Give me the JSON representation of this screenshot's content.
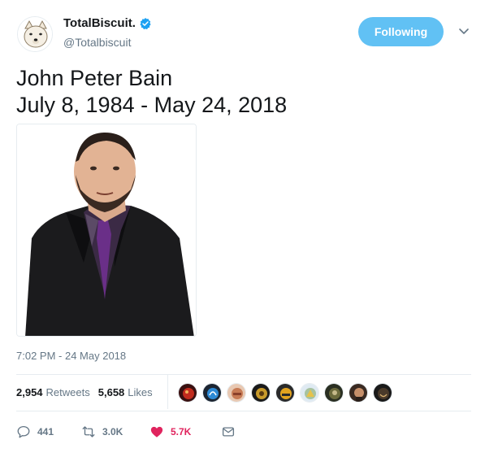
{
  "header": {
    "display_name": "TotalBiscuit.",
    "handle": "@Totalbiscuit",
    "verified_icon": "verified-badge-icon",
    "follow_button_label": "Following",
    "menu_icon": "chevron-down-icon"
  },
  "tweet": {
    "line1": "John Peter Bain",
    "line2": "July 8, 1984 - May 24, 2018",
    "timestamp": "7:02 PM - 24 May 2018"
  },
  "stats": {
    "retweets_count": "2,954",
    "retweets_label": "Retweets",
    "likes_count": "5,658",
    "likes_label": "Likes",
    "liker_avatars": 9
  },
  "actions": {
    "reply_count": "441",
    "retweet_count": "3.0K",
    "like_count": "5.7K"
  },
  "colors": {
    "accent": "#61c1f4",
    "like": "#e0245e",
    "muted": "#657786",
    "border": "#e6ecf0",
    "verified": "#1da1f2"
  }
}
